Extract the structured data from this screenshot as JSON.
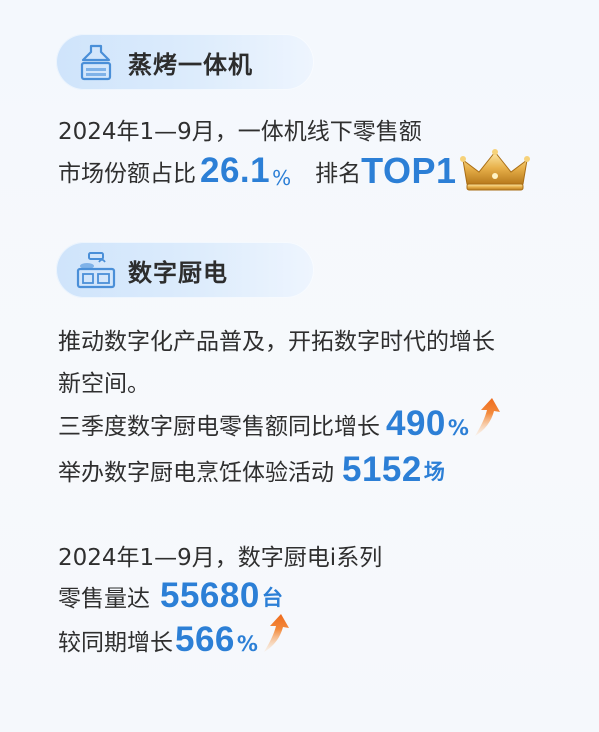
{
  "section1": {
    "title": "蒸烤一体机",
    "line1": "2024年1—9月，一体机线下零售额",
    "line2_prefix": "市场份额占比",
    "share_value": "26.1",
    "share_unit": "%",
    "rank_label": "排名",
    "rank_value": "TOP1",
    "icon": "range-hood-oven-icon"
  },
  "section2": {
    "title": "数字厨电",
    "icon": "kitchen-stove-icon",
    "desc_line1": "推动数字化产品普及，开拓数字时代的增长",
    "desc_line2": "新空间。",
    "growth_prefix": "三季度数字厨电零售额同比增长",
    "growth_value": "490",
    "growth_unit": "%",
    "events_prefix": "举办数字厨电烹饪体验活动",
    "events_value": "5152",
    "events_unit": "场",
    "series_line": "2024年1—9月，数字厨电i系列",
    "sales_prefix": "零售量达",
    "sales_value": "55680",
    "sales_unit": "台",
    "yoy_prefix": "较同期增长",
    "yoy_value": "566",
    "yoy_unit": "%"
  },
  "colors": {
    "accent": "#2c7fd6",
    "pill_start": "#cfe4fb",
    "arrow_orange": "#f07a2a",
    "crown_gold": "#e0a93a"
  }
}
